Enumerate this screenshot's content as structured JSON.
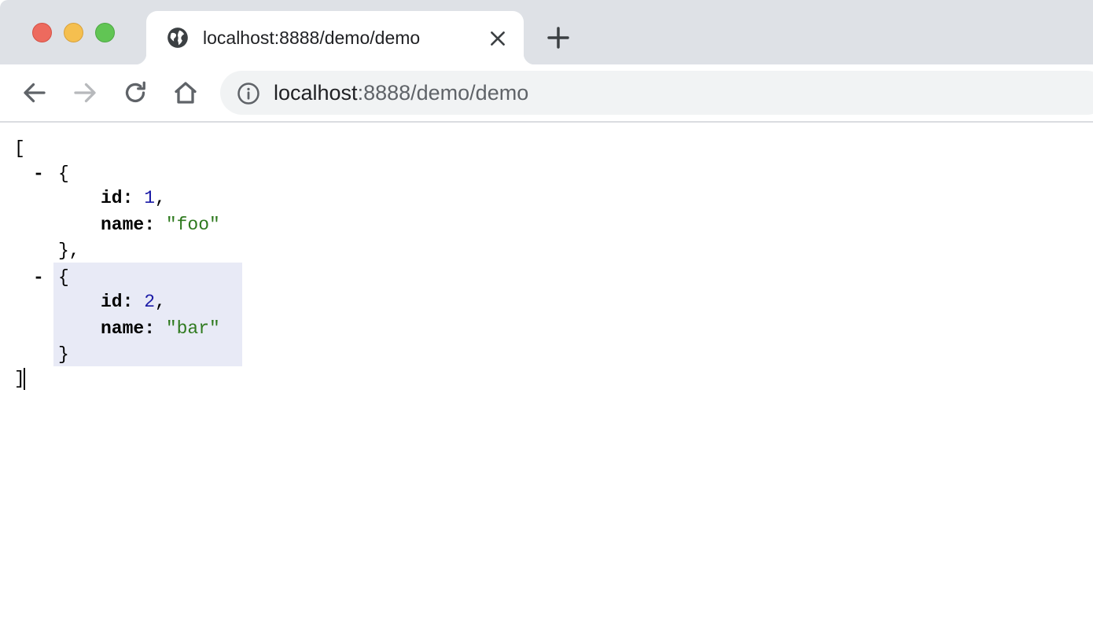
{
  "browser": {
    "tab": {
      "title": "localhost:8888/demo/demo",
      "favicon_icon": "globe-icon",
      "close_icon": "close-icon"
    },
    "new_tab_icon": "plus-icon",
    "toolbar": {
      "back_icon": "arrow-left-icon",
      "forward_icon": "arrow-right-icon",
      "reload_icon": "reload-icon",
      "home_icon": "home-icon"
    },
    "address_bar": {
      "info_icon": "info-icon",
      "host": "localhost",
      "path": ":8888/demo/demo"
    },
    "colors": {
      "traffic_close": "#ed6a5e",
      "traffic_minimize": "#f5bf4f",
      "traffic_maximize": "#61c554"
    }
  },
  "json_view": {
    "open_bracket": "[",
    "close_bracket": "]",
    "collapse_symbol": "-",
    "items": [
      {
        "open_brace": "{",
        "close_brace": "},",
        "fields": [
          {
            "key": "id:",
            "value": "1",
            "suffix": ","
          },
          {
            "key": "name:",
            "value": "\"foo\"",
            "suffix": ""
          }
        ]
      },
      {
        "open_brace": "{",
        "close_brace": "}",
        "fields": [
          {
            "key": "id:",
            "value": "2",
            "suffix": ","
          },
          {
            "key": "name:",
            "value": "\"bar\"",
            "suffix": ""
          }
        ]
      }
    ],
    "colors": {
      "number": "#1a1aa6",
      "string": "#2f7a1f",
      "selection": "#e8eaf6"
    }
  }
}
